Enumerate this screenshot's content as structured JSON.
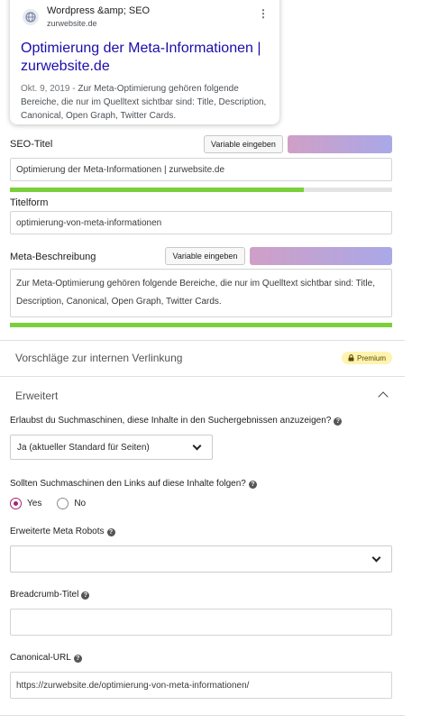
{
  "preview": {
    "site_name": "Wordpress &amp; SEO",
    "site_url": "zurwebsite.de",
    "menu_glyph": "⋮",
    "title": "Optimierung der Meta-Informationen | zurwebsite.de",
    "date": "Okt. 9, 2019",
    "date_separator": " - ",
    "description": "Zur Meta-Optimierung gehören folgende Bereiche, die nur im Quelltext sichtbar sind: Title, Description, Canonical, Open Graph, Twitter Cards."
  },
  "seo_title": {
    "label": "SEO-Titel",
    "button_label": "Variable eingeben",
    "value": "Optimierung der Meta-Informationen | zurwebsite.de",
    "progress": 0.77
  },
  "slug": {
    "label": "Titelform",
    "value": "optimierung-von-meta-informationen"
  },
  "meta_description": {
    "label": "Meta-Beschreibung",
    "button_label": "Variable eingeben",
    "value": "Zur Meta-Optimierung gehören folgende Bereiche, die nur im Quelltext sichtbar sind: Title, Description, Canonical, Open Graph, Twitter Cards.",
    "progress": 1.0
  },
  "internal_links": {
    "title": "Vorschläge zur internen Verlinkung",
    "badge_label": "Premium"
  },
  "advanced": {
    "title": "Erweitert",
    "index_question": "Erlaubst du Suchmaschinen, diese Inhalte in den Suchergebnissen anzuzeigen?",
    "index_value": "Ja (aktueller Standard für Seiten)",
    "follow_question": "Sollten Suchmaschinen den Links auf diese Inhalte folgen?",
    "follow_yes": "Yes",
    "follow_no": "No",
    "meta_robots_label": "Erweiterte Meta Robots",
    "meta_robots_value": "",
    "breadcrumb_label": "Breadcrumb-Titel",
    "breadcrumb_value": "",
    "canonical_label": "Canonical-URL",
    "canonical_value": "https://zurwebsite.de/optimierung-von-meta-informationen/"
  },
  "colors": {
    "link_blue": "#1a0dab",
    "progress_green": "#7ad03a",
    "radio_accent": "#a4286a",
    "premium_bg": "#fff3b0"
  },
  "icons": {
    "favicon": "globe-icon",
    "menu": "more-vertical-icon",
    "lock": "lock-icon",
    "help": "help-circle-icon",
    "chevron_up": "chevron-up-icon",
    "chevron_down": "chevron-down-icon"
  }
}
